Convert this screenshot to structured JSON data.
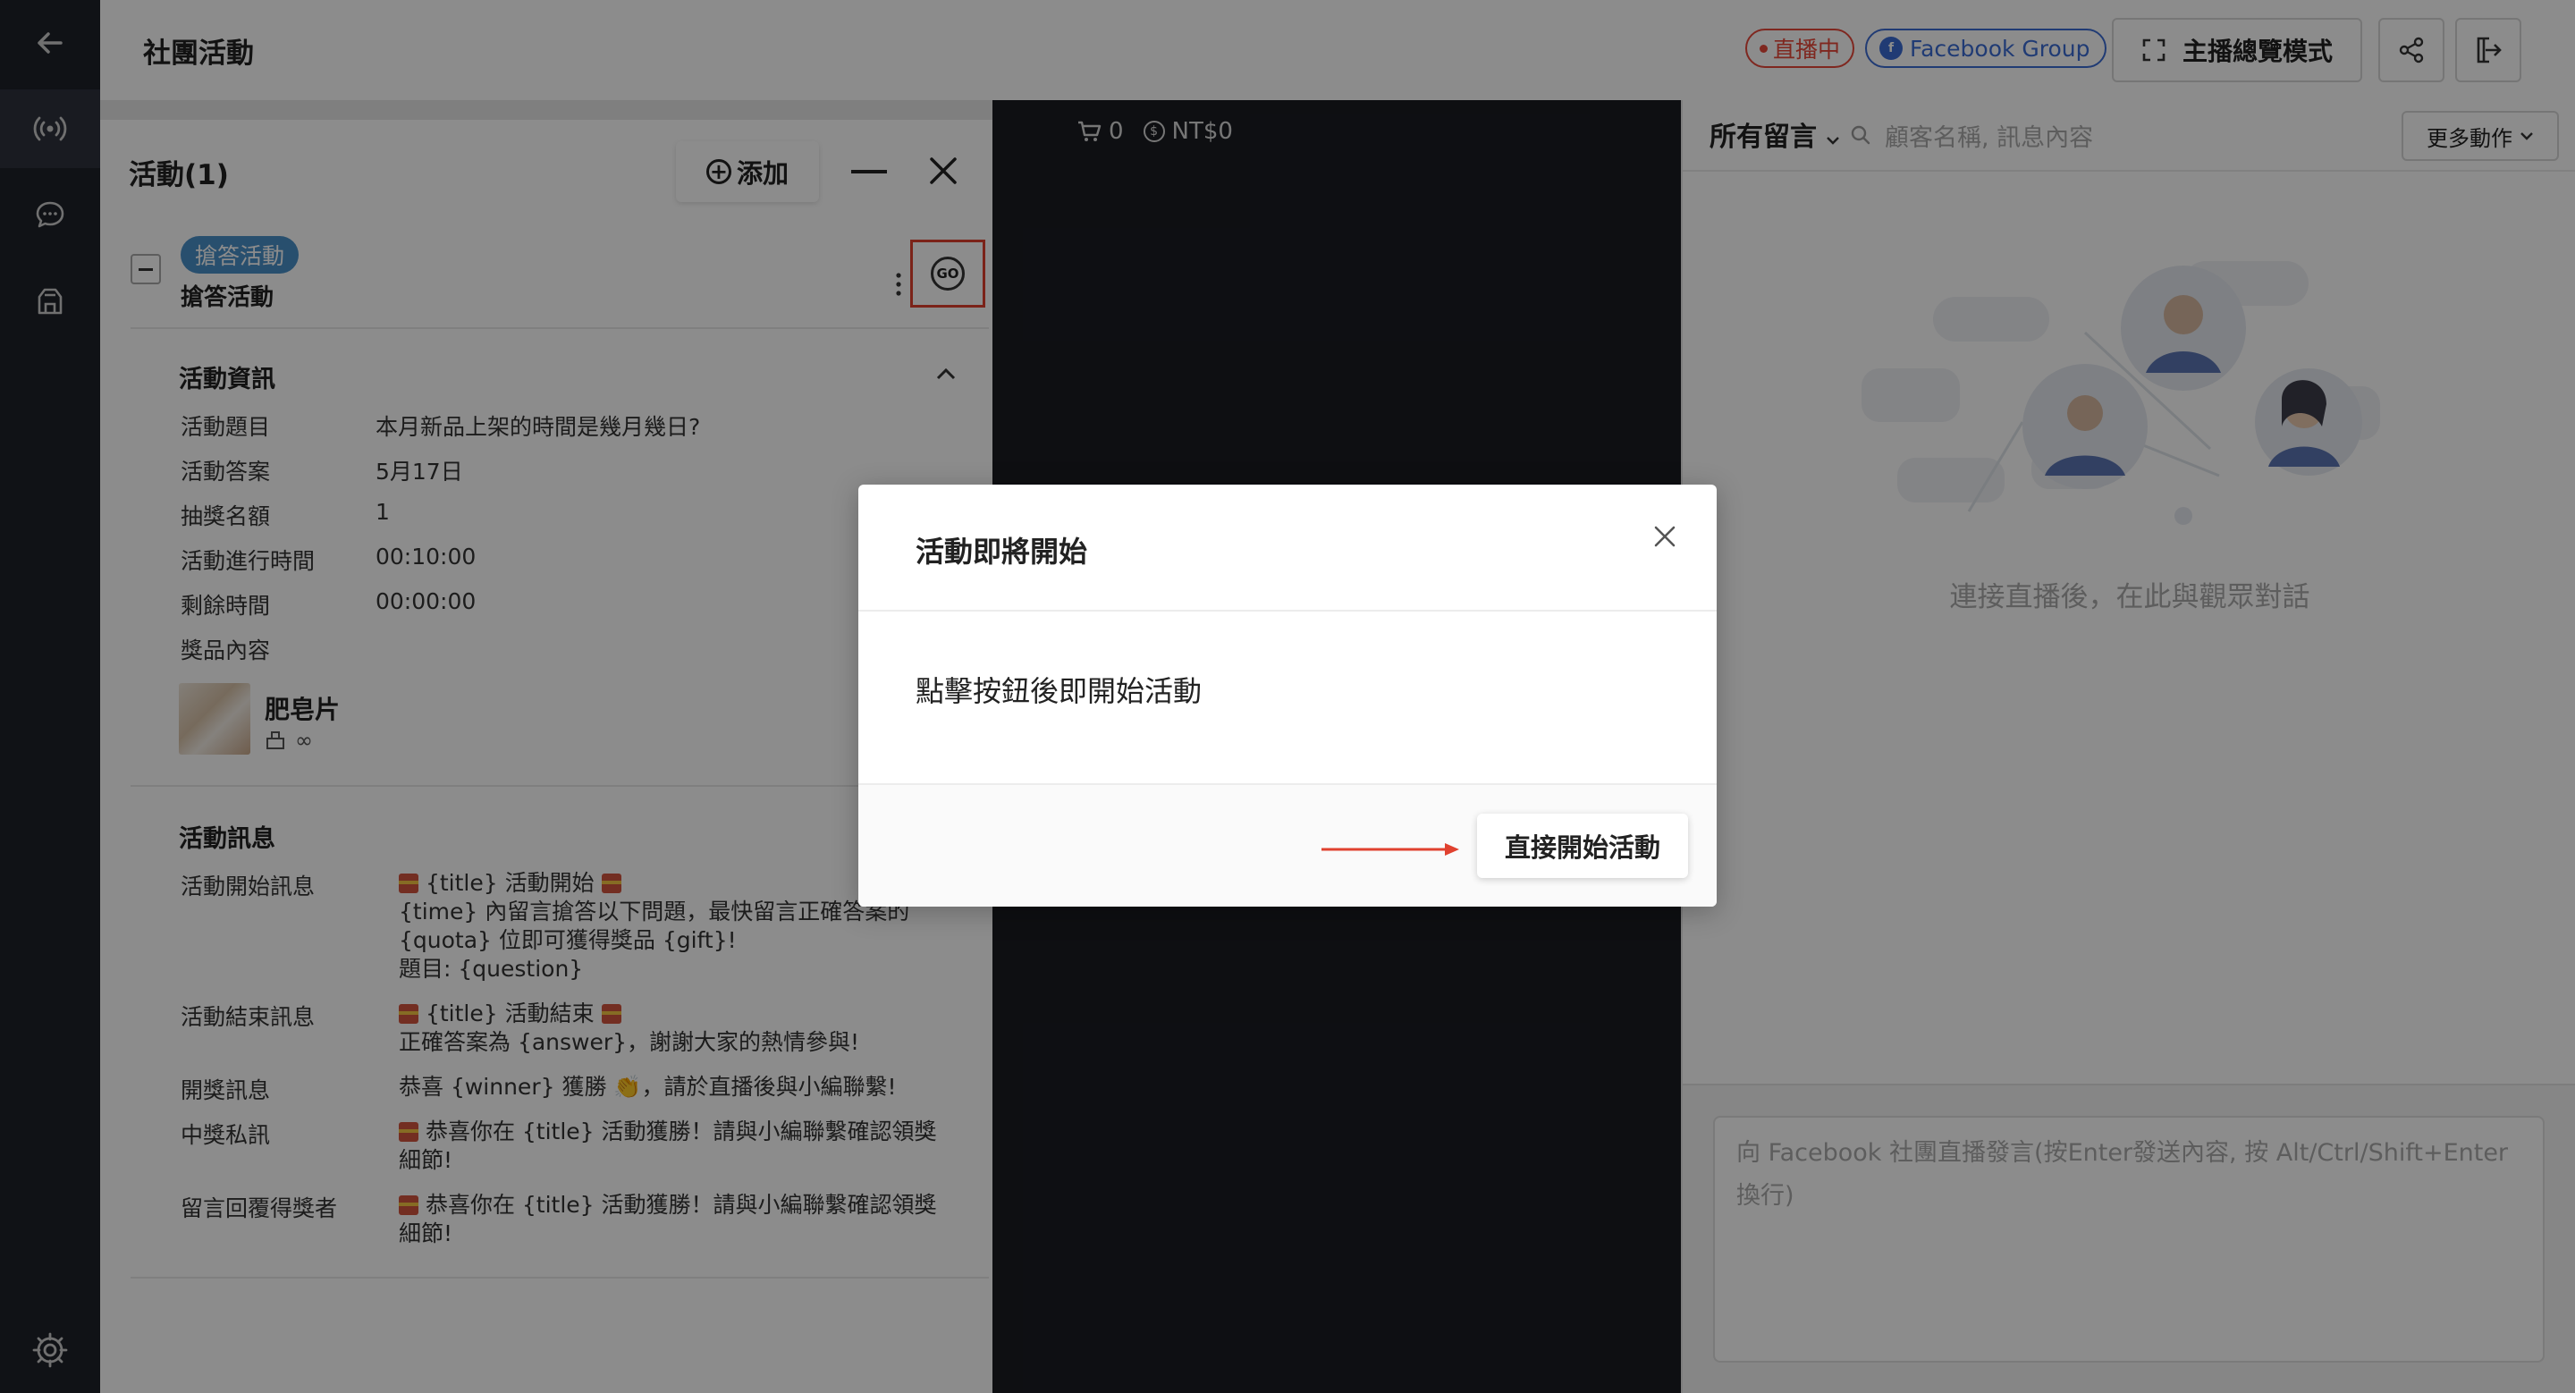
{
  "header": {
    "title": "社團活動",
    "live_badge": "直播中",
    "platform_badge": "Facebook Group",
    "overview_button": "主播總覽模式"
  },
  "nav": {
    "items": [
      "back-arrow-icon",
      "broadcast-icon",
      "chat-icon",
      "store-icon",
      "settings-icon"
    ]
  },
  "activity_panel": {
    "title": "活動(1)",
    "add_button": "添加",
    "activity": {
      "tag": "搶答活動",
      "name": "搶答活動"
    },
    "info_section": {
      "title": "活動資訊",
      "rows": [
        {
          "label": "活動題目",
          "value": "本月新品上架的時間是幾月幾日?"
        },
        {
          "label": "活動答案",
          "value": "5月17日"
        },
        {
          "label": "抽獎名額",
          "value": "1"
        },
        {
          "label": "活動進行時間",
          "value": "00:10:00"
        },
        {
          "label": "剩餘時間",
          "value": "00:00:00"
        },
        {
          "label": "獎品內容",
          "value": ""
        }
      ],
      "prize": {
        "name": "肥皂片",
        "stock": "∞"
      }
    },
    "message_section": {
      "title": "活動訊息",
      "rows": [
        {
          "label": "活動開始訊息",
          "lines": [
            "{title} 活動開始",
            "{time} 內留言搶答以下問題，最快留言正確答案的",
            "{quota} 位即可獲得獎品 {gift}!",
            "題目: {question}"
          ]
        },
        {
          "label": "活動結束訊息",
          "lines": [
            "{title} 活動結束",
            "正確答案為 {answer}，謝謝大家的熱情參與!"
          ]
        },
        {
          "label": "開獎訊息",
          "lines": [
            "恭喜 {winner} 獲勝 👏，請於直播後與小編聯繫!"
          ]
        },
        {
          "label": "中獎私訊",
          "lines": [
            "恭喜你在 {title} 活動獲勝！請與小編聯繫確認領獎",
            "細節!"
          ]
        },
        {
          "label": "留言回覆得獎者",
          "lines": [
            "恭喜你在 {title} 活動獲勝！請與小編聯繫確認領獎",
            "細節!"
          ]
        }
      ]
    }
  },
  "video": {
    "cart_count": "0",
    "amount": "NT$0"
  },
  "comments": {
    "filter": "所有留言",
    "search_placeholder": "顧客名稱, 訊息內容",
    "more_actions": "更多動作",
    "empty_text": "連接直播後，在此與觀眾對話",
    "composer_placeholder": "向 Facebook 社團直播發言(按Enter發送內容, 按 Alt/Ctrl/Shift+Enter 換行)"
  },
  "modal": {
    "title": "活動即將開始",
    "body": "點擊按鈕後即開始活動",
    "start_button": "直接開始活動"
  },
  "colors": {
    "nav_bg": "#1e2129",
    "live_red": "#e8473a",
    "facebook_blue": "#3b6cd4",
    "tag_blue": "#4a90c8",
    "highlight_red": "#e0412f"
  }
}
